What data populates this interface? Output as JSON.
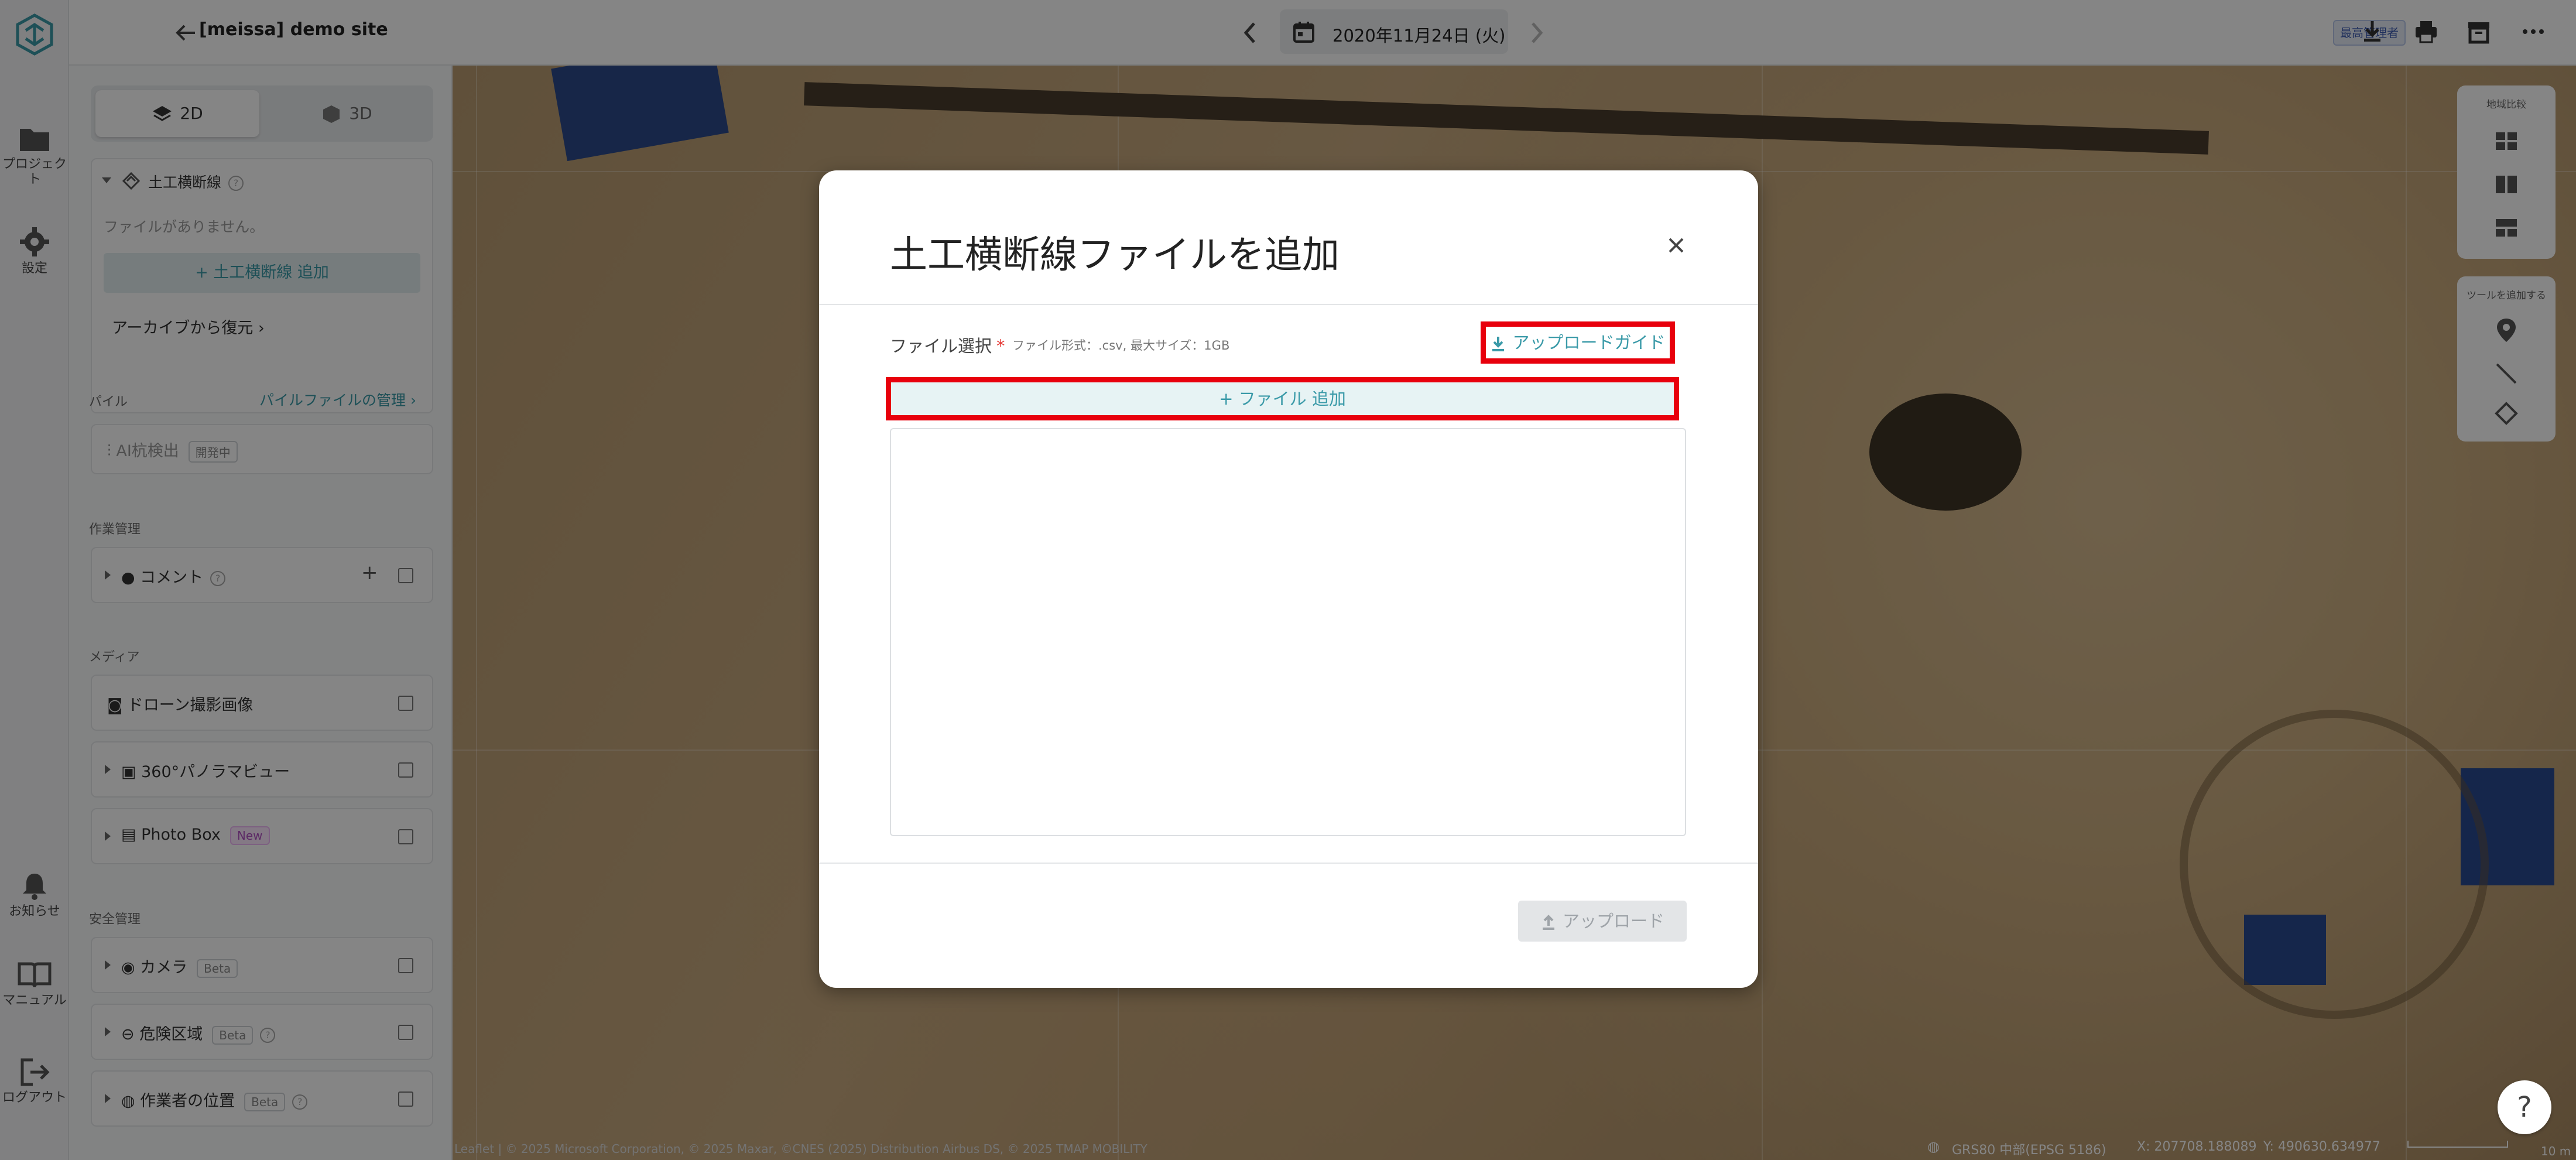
{
  "rail": {
    "items": [
      {
        "label": "プロジェクト",
        "icon": "folder-icon"
      },
      {
        "label": "設定",
        "icon": "gear-icon"
      },
      {
        "label": "お知らせ",
        "icon": "bell-icon"
      },
      {
        "label": "マニュアル",
        "icon": "book-icon"
      },
      {
        "label": "ログアウト",
        "icon": "logout-icon"
      }
    ]
  },
  "header": {
    "site_title": "[meissa] demo site",
    "date": "2020年11月24日 (火)",
    "role_badge": "最高管理者"
  },
  "sidebar": {
    "mode_2d": "2D",
    "mode_3d": "3D",
    "earthwork": {
      "title": "土工横断線",
      "empty": "ファイルがありません。",
      "add_label": "土工横断線 追加",
      "restore": "アーカイブから復元"
    },
    "pile": {
      "section": "パイル",
      "manage_link": "パイルファイルの管理",
      "ai_detect": "AI杭検出",
      "ai_tag": "開発中"
    },
    "work_section": "作業管理",
    "comment": "コメント",
    "media_section": "メディア",
    "drone": "ドローン撮影画像",
    "panorama": "360°パノラマビュー",
    "photobox": "Photo Box",
    "photobox_tag": "New",
    "safety_section": "安全管理",
    "camera": "カメラ",
    "danger": "危険区域",
    "worker": "作業者の位置",
    "beta": "Beta"
  },
  "map": {
    "compare_label": "地域比較",
    "tools_label": "ツールを追加する",
    "attribution": "Leaflet | © 2025 Microsoft Corporation, © 2025 Maxar, ©CNES (2025) Distribution Airbus DS, © 2025 TMAP MOBILITY",
    "crs": "GRS80 中部(EPSG 5186)",
    "x": "X: 207708.188089",
    "y": "Y: 490630.634977",
    "scale": "10 m",
    "help": "?"
  },
  "modal": {
    "title": "土工横断線ファイルを追加",
    "field_label": "ファイル選択",
    "required": "*",
    "hint": "ファイル形式：.csv, 最大サイズ：1GB",
    "guide": "アップロードガイド",
    "add_file": "+ ファイル 追加",
    "upload": "アップロード"
  },
  "colors": {
    "accent": "#3a9aa8",
    "highlight": "#e8000c",
    "overlay": "rgba(0,0,0,0.48)"
  }
}
